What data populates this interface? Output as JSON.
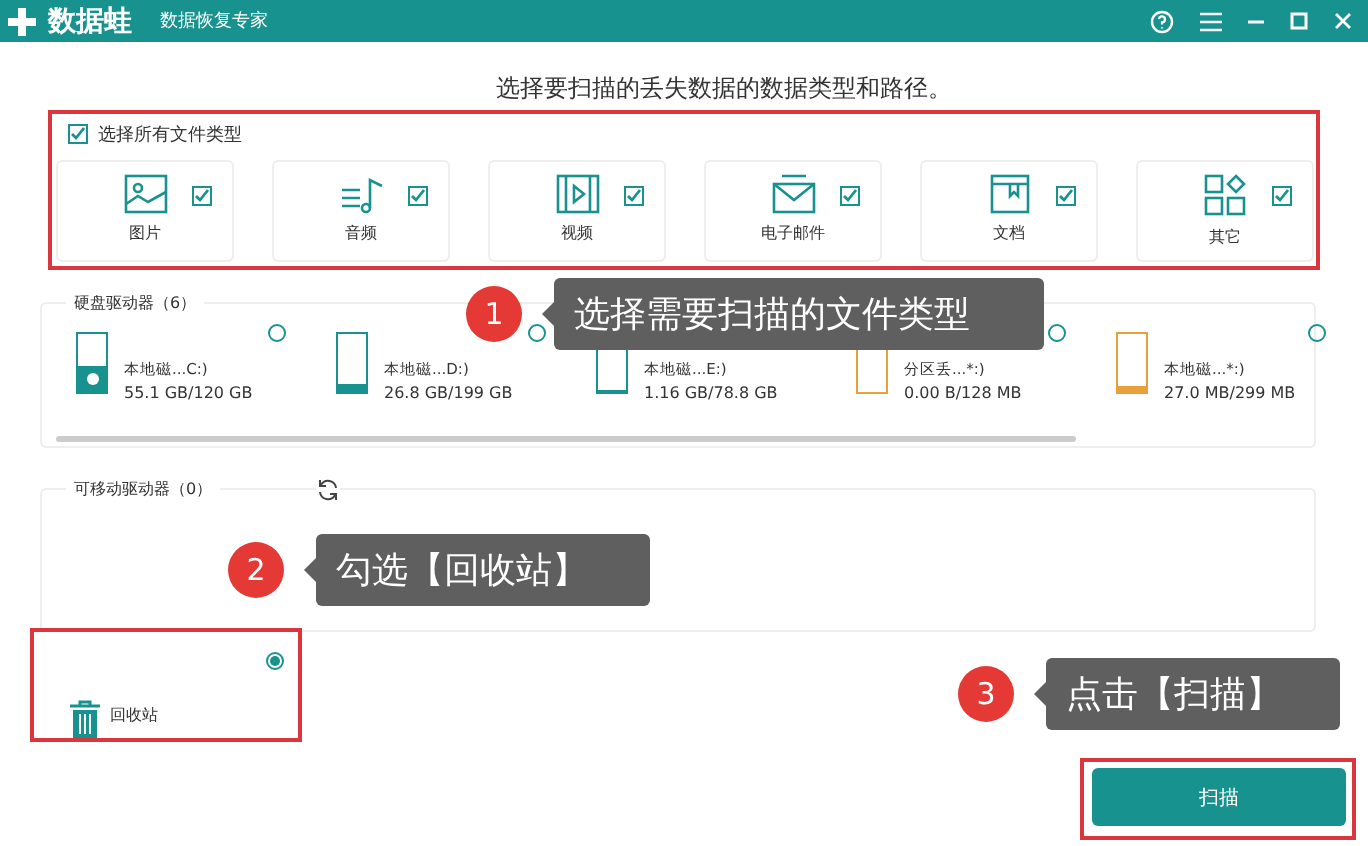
{
  "window": {
    "app_name": "数据蛙",
    "subtitle": "数据恢复专家"
  },
  "heading": "选择要扫描的丢失数据的数据类型和路径。",
  "select_all": {
    "label": "选择所有文件类型",
    "checked": true
  },
  "file_types": [
    {
      "label": "图片",
      "kind": "image",
      "checked": true
    },
    {
      "label": "音频",
      "kind": "audio",
      "checked": true
    },
    {
      "label": "视频",
      "kind": "video",
      "checked": true
    },
    {
      "label": "电子邮件",
      "kind": "email",
      "checked": true
    },
    {
      "label": "文档",
      "kind": "document",
      "checked": true
    },
    {
      "label": "其它",
      "kind": "other",
      "checked": true
    }
  ],
  "hard_drives": {
    "title": "硬盘驱动器（6）",
    "items": [
      {
        "name": "本地磁...C:)",
        "size": "55.1 GB/120 GB",
        "level": 0.46,
        "color": "#17928e",
        "kind": "system",
        "selected": false
      },
      {
        "name": "本地磁...D:)",
        "size": "26.8 GB/199 GB",
        "level": 0.13,
        "color": "#17928e",
        "kind": "disk",
        "selected": false
      },
      {
        "name": "本地磁...E:)",
        "size": "1.16 GB/78.8 GB",
        "level": 0.02,
        "color": "#17928e",
        "kind": "disk"
      },
      {
        "name": "分区丢...*:)",
        "size": "0.00  B/128 MB",
        "level": 0,
        "color": "#e8a13a",
        "kind": "disk",
        "selected": false
      },
      {
        "name": "本地磁...*:)",
        "size": "27.0 MB/299 MB",
        "level": 0.09,
        "color": "#e8a13a",
        "kind": "disk",
        "selected": false
      }
    ]
  },
  "removable_drives": {
    "title": "可移动驱动器（0）"
  },
  "recycle_bin": {
    "label": "回收站",
    "selected": true
  },
  "scan_button": "扫描",
  "callouts": [
    {
      "number": "1",
      "text": "选择需要扫描的文件类型"
    },
    {
      "number": "2",
      "text": "勾选【回收站】"
    },
    {
      "number": "3",
      "text": "点击【扫描】"
    }
  ]
}
